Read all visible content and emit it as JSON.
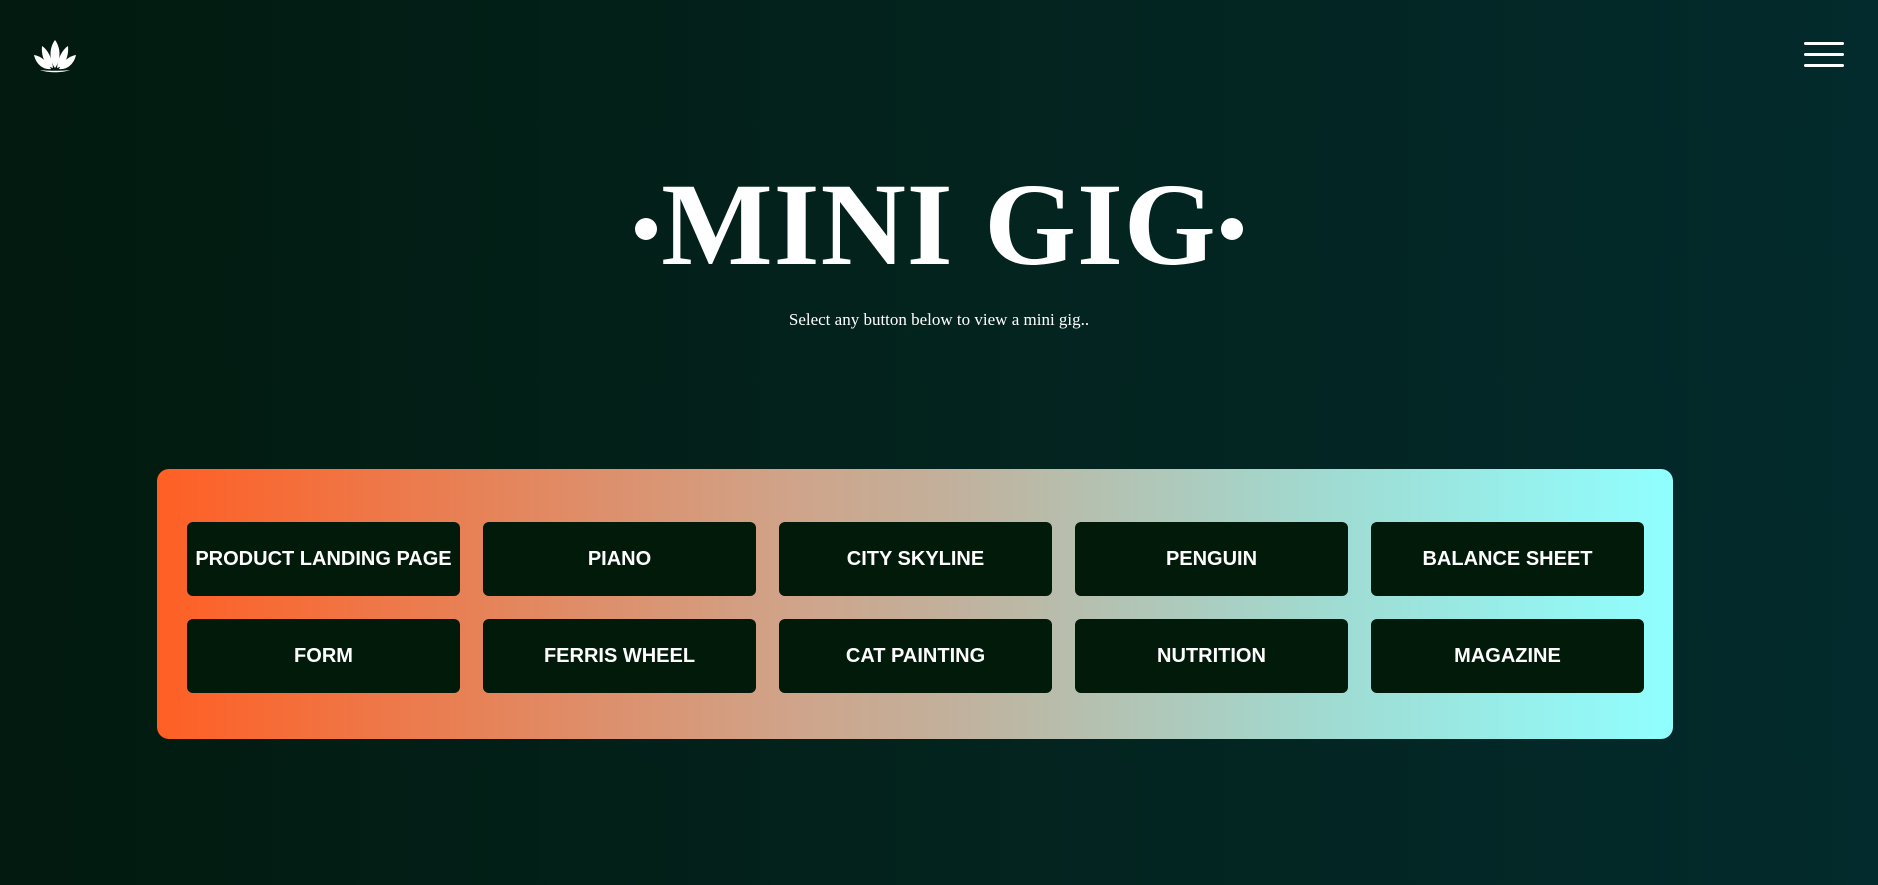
{
  "header": {
    "logo_icon": "lotus-logo-icon",
    "menu_icon": "hamburger-menu-icon"
  },
  "hero": {
    "title": "MINI GIG",
    "subtitle": "Select any button below to view a mini gig.."
  },
  "gigs": [
    {
      "label": "PRODUCT LANDING PAGE"
    },
    {
      "label": "PIANO"
    },
    {
      "label": "CITY SKYLINE"
    },
    {
      "label": "PENGUIN"
    },
    {
      "label": "BALANCE SHEET"
    },
    {
      "label": "FORM"
    },
    {
      "label": "FERRIS WHEEL"
    },
    {
      "label": "CAT PAINTING"
    },
    {
      "label": "NUTRITION"
    },
    {
      "label": "MAGAZINE"
    }
  ],
  "colors": {
    "background_start": "#021a0f",
    "background_end": "#032a2c",
    "panel_gradient_start": "#ff5f24",
    "panel_gradient_end": "#90ffff",
    "button_background": "#021a0a",
    "text": "#ffffff"
  }
}
